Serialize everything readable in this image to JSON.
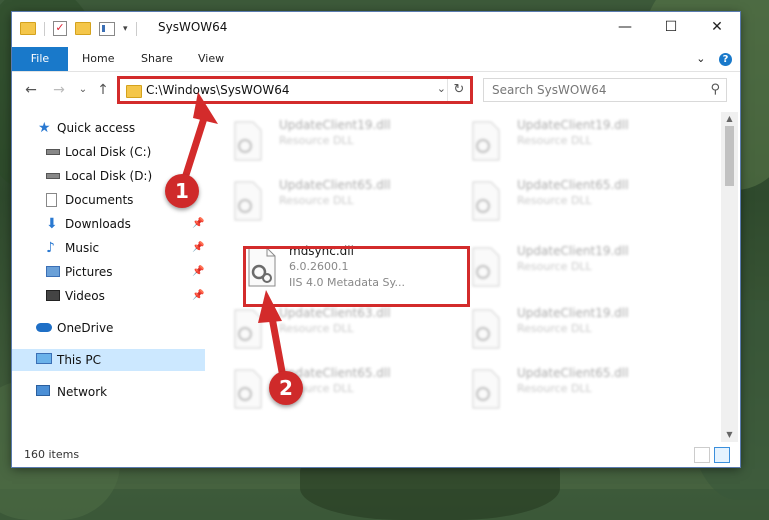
{
  "window": {
    "title": "SysWOW64",
    "minimize_glyph": "—",
    "maximize_glyph": "☐",
    "close_glyph": "✕"
  },
  "ribbon": {
    "tabs": [
      "File",
      "Home",
      "Share",
      "View"
    ],
    "expand_glyph": "⌄",
    "help_glyph": "?"
  },
  "nav": {
    "back_glyph": "←",
    "forward_glyph": "→",
    "recent_glyph": "⌄",
    "up_glyph": "↑",
    "address": "C:\\Windows\\SysWOW64",
    "dropdown_glyph": "⌄",
    "refresh_glyph": "↻",
    "search_placeholder": "Search SysWOW64",
    "search_glyph": "⚲"
  },
  "sidebar": {
    "items": [
      {
        "label": "Quick access",
        "icon": "star-icon"
      },
      {
        "label": "Local Disk (C:)",
        "icon": "drive-icon"
      },
      {
        "label": "Local Disk (D:)",
        "icon": "drive-icon"
      },
      {
        "label": "Documents",
        "icon": "documents-icon"
      },
      {
        "label": "Downloads",
        "icon": "download-icon"
      },
      {
        "label": "Music",
        "icon": "music-icon"
      },
      {
        "label": "Pictures",
        "icon": "pictures-icon"
      },
      {
        "label": "Videos",
        "icon": "videos-icon"
      },
      {
        "label": "OneDrive",
        "icon": "cloud-icon"
      },
      {
        "label": "This PC",
        "icon": "computer-icon"
      },
      {
        "label": "Network",
        "icon": "network-icon"
      }
    ],
    "pin_glyph": "📌"
  },
  "files": [
    {
      "name": "UpdateClient19.dll",
      "sub": "Resource DLL"
    },
    {
      "name": "UpdateClient19.dll",
      "sub": "Resource DLL"
    },
    {
      "name": "UpdateClient65.dll",
      "sub": "Resource DLL"
    },
    {
      "name": "UpdateClient65.dll",
      "sub": "Resource DLL"
    },
    {
      "name": "mdsync.dll",
      "sub": "6.0.2600.1",
      "desc": "IIS 4.0 Metadata Sy..."
    },
    {
      "name": "UpdateClient19.dll",
      "sub": "Resource DLL"
    },
    {
      "name": "UpdateClient63.dll",
      "sub": "Resource DLL"
    },
    {
      "name": "UpdateClient19.dll",
      "sub": "Resource DLL"
    },
    {
      "name": "UpdateClient65.dll",
      "sub": "Resource DLL"
    },
    {
      "name": "UpdateClient65.dll",
      "sub": "Resource DLL"
    }
  ],
  "status": {
    "count": "160 items"
  },
  "annotations": {
    "step1": "1",
    "step2": "2"
  },
  "colors": {
    "accent": "#1979ca",
    "highlight": "#d32b2b",
    "selection": "#cce8ff"
  }
}
